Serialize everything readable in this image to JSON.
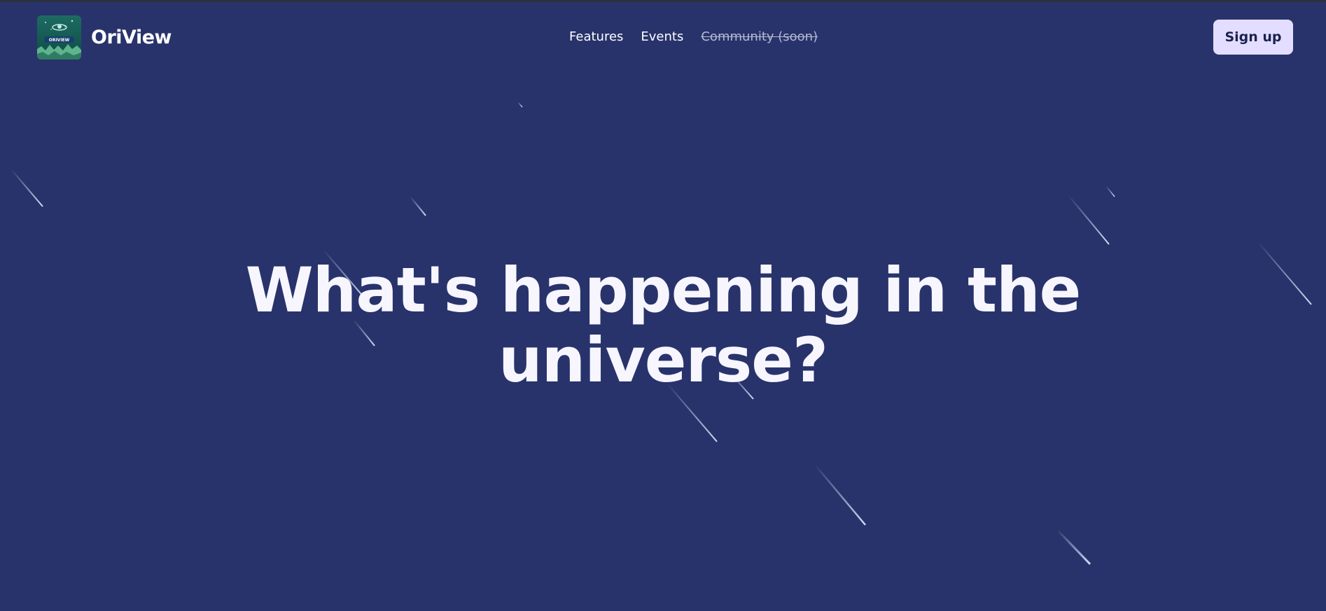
{
  "header": {
    "brand": "OriView",
    "logo_badge": "ORIVIEW"
  },
  "nav": {
    "features": "Features",
    "events": "Events",
    "community": "Community (soon)"
  },
  "actions": {
    "signup": "Sign up"
  },
  "hero": {
    "line1": "What's happening in the",
    "line2": "universe?"
  },
  "colors": {
    "background": "#28336b",
    "signup_bg": "#e3deff",
    "signup_text": "#1d2251",
    "disabled_link": "#b6b9d3",
    "streak": "#dfe6ff"
  }
}
